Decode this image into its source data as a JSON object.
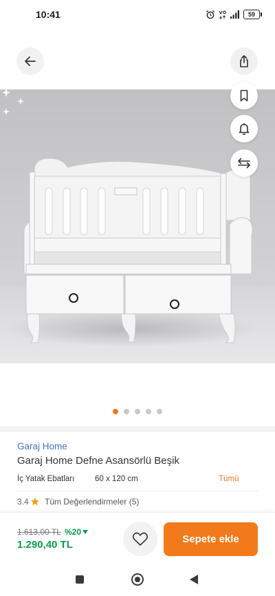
{
  "status_bar": {
    "time": "10:41",
    "battery_level": "59",
    "icons": [
      "alarm-icon",
      "volte-icon",
      "signal-icon",
      "battery-icon"
    ]
  },
  "header": {
    "back_icon": "arrow-left-icon",
    "share_icon": "share-icon"
  },
  "gallery": {
    "slide_count": 5,
    "active_slide": 1,
    "action_icons": [
      "bookmark-icon",
      "bell-icon",
      "compare-icon"
    ]
  },
  "product": {
    "brand": "Garaj Home",
    "title": "Garaj Home Defne Asansörlü Beşik"
  },
  "variant": {
    "label": "İç Yatak Ebatları",
    "value": "60 x 120 cm",
    "all_link": "Tümü"
  },
  "rating": {
    "score": "3.4",
    "reviews_link": "Tüm Değerlendirmeler (5)",
    "star_icon": "star-icon"
  },
  "price": {
    "original": "1.613,00 TL",
    "discount": "%20",
    "current": "1.290,40 TL"
  },
  "actions": {
    "favorite_icon": "heart-icon",
    "add_to_cart": "Sepete ekle"
  },
  "nav_bar": {
    "icons": [
      "recent-apps-icon",
      "home-icon",
      "back-icon"
    ]
  },
  "colors": {
    "accent": "#f27a1a",
    "brand_link": "#4b72c2",
    "price_green": "#0c9b4b",
    "dot_inactive": "#c9c9c9"
  }
}
